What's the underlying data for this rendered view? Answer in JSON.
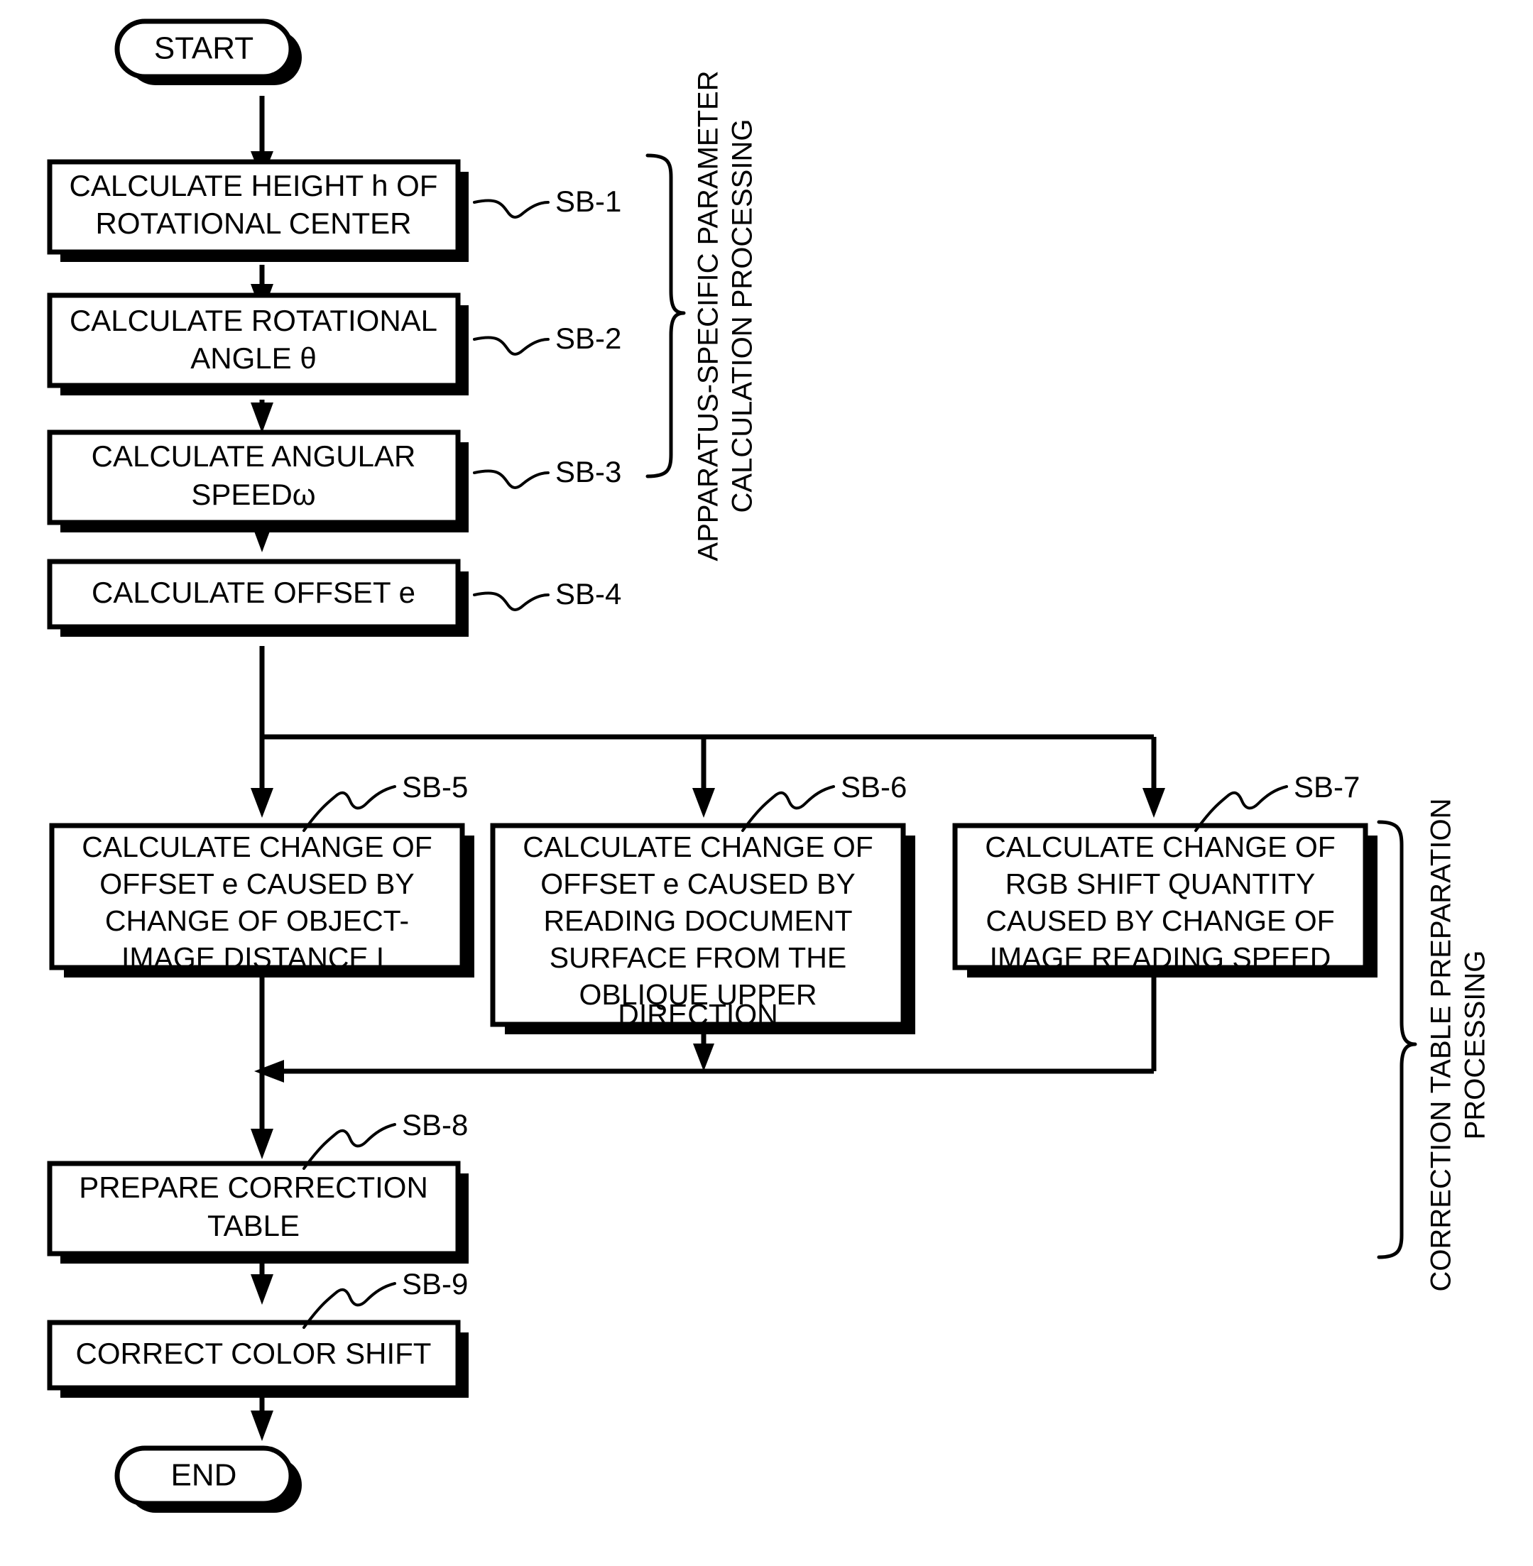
{
  "diagram": {
    "type": "flowchart",
    "terminals": {
      "start": "START",
      "end": "END"
    },
    "nodes": [
      {
        "id": "SB-1",
        "ref": "SB-1",
        "lines": [
          "CALCULATE HEIGHT h OF",
          "ROTATIONAL CENTER"
        ]
      },
      {
        "id": "SB-2",
        "ref": "SB-2",
        "lines": [
          "CALCULATE ROTATIONAL",
          "ANGLE θ"
        ]
      },
      {
        "id": "SB-3",
        "ref": "SB-3",
        "lines": [
          "CALCULATE ANGULAR",
          "SPEEDω"
        ]
      },
      {
        "id": "SB-4",
        "ref": "SB-4",
        "lines": [
          "CALCULATE OFFSET e"
        ]
      },
      {
        "id": "SB-5",
        "ref": "SB-5",
        "lines": [
          "CALCULATE CHANGE OF",
          "OFFSET e CAUSED BY",
          "CHANGE OF OBJECT-",
          "IMAGE DISTANCE L"
        ]
      },
      {
        "id": "SB-6",
        "ref": "SB-6",
        "lines": [
          "CALCULATE CHANGE OF",
          "OFFSET e CAUSED BY",
          "READING DOCUMENT",
          "SURFACE FROM THE",
          "OBLIQUE UPPER",
          "DIRECTION"
        ]
      },
      {
        "id": "SB-7",
        "ref": "SB-7",
        "lines": [
          "CALCULATE CHANGE OF",
          "RGB SHIFT QUANTITY",
          "CAUSED BY CHANGE OF",
          "IMAGE READING SPEED"
        ]
      },
      {
        "id": "SB-8",
        "ref": "SB-8",
        "lines": [
          "PREPARE CORRECTION",
          "TABLE"
        ]
      },
      {
        "id": "SB-9",
        "ref": "SB-9",
        "lines": [
          "CORRECT COLOR SHIFT"
        ]
      }
    ],
    "group_labels": {
      "upper": [
        "APPARATUS-SPECIFIC PARAMETER",
        "CALCULATION PROCESSING"
      ],
      "lower": [
        "CORRECTION TABLE PREPARATION",
        "PROCESSING"
      ]
    },
    "colors": {
      "stroke": "#000000",
      "fill": "#ffffff",
      "shadow": "#000000"
    }
  }
}
